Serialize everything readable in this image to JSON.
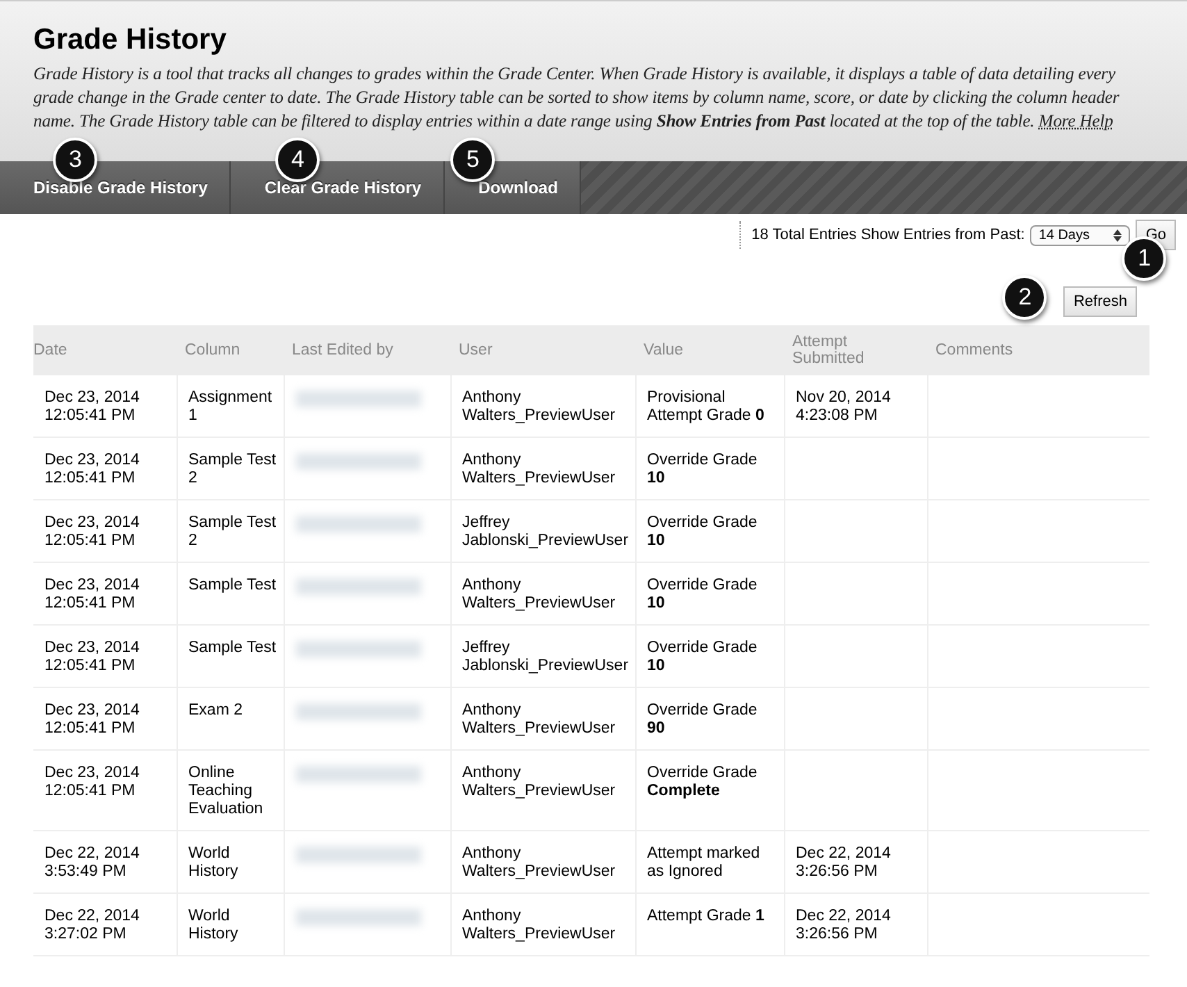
{
  "header": {
    "title": "Grade History",
    "description": "Grade History is a tool that tracks all changes to grades within the Grade Center. When Grade History is available, it displays a table of data detailing every grade change in the Grade center to date. The Grade History table can be sorted to show items by column name, score, or date by clicking the column header name. The Grade History table can be filtered to display entries within a date range using **Show Entries from Past** located at the top of the table.",
    "help_link": "More Help"
  },
  "toolbar": [
    {
      "label": "Disable Grade History",
      "callout": "3"
    },
    {
      "label": "Clear Grade History",
      "callout": "4"
    },
    {
      "label": "Download",
      "callout": "5"
    }
  ],
  "filter": {
    "total": "18 Total Entries",
    "label": "Show Entries from Past:",
    "select": "14 Days",
    "button": "Go",
    "callout": "1"
  },
  "refresh": {
    "label": "Refresh",
    "callout": "2"
  },
  "table": {
    "columns": [
      "Date",
      "Column",
      "Last Edited by",
      "User",
      "Value",
      "Attempt Submitted",
      "Comments"
    ],
    "rows": [
      {
        "date": "Dec 23, 2014 12:05:41 PM",
        "column": "Assignment 1",
        "user": "Anthony Walters_PreviewUser",
        "value": "Provisional Attempt Grade **0**",
        "attempt": "Nov 20, 2014 4:23:08 PM"
      },
      {
        "date": "Dec 23, 2014 12:05:41 PM",
        "column": "Sample Test 2",
        "user": "Anthony Walters_PreviewUser",
        "value": "Override Grade **10**",
        "attempt": ""
      },
      {
        "date": "Dec 23, 2014 12:05:41 PM",
        "column": "Sample Test 2",
        "user": "Jeffrey Jablonski_PreviewUser",
        "value": "Override Grade **10**",
        "attempt": ""
      },
      {
        "date": "Dec 23, 2014 12:05:41 PM",
        "column": "Sample Test",
        "user": "Anthony Walters_PreviewUser",
        "value": "Override Grade **10**",
        "attempt": ""
      },
      {
        "date": "Dec 23, 2014 12:05:41 PM",
        "column": "Sample Test",
        "user": "Jeffrey Jablonski_PreviewUser",
        "value": "Override Grade **10**",
        "attempt": ""
      },
      {
        "date": "Dec 23, 2014 12:05:41 PM",
        "column": "Exam 2",
        "user": "Anthony Walters_PreviewUser",
        "value": "Override Grade **90**",
        "attempt": ""
      },
      {
        "date": "Dec 23, 2014 12:05:41 PM",
        "column": "Online Teaching Evaluation",
        "user": "Anthony Walters_PreviewUser",
        "value": "Override Grade **Complete**",
        "attempt": ""
      },
      {
        "date": "Dec 22, 2014 3:53:49 PM",
        "column": "World History",
        "user": "Anthony Walters_PreviewUser",
        "value": "Attempt marked as Ignored",
        "attempt": "Dec 22, 2014 3:26:56 PM"
      },
      {
        "date": "Dec 22, 2014 3:27:02 PM",
        "column": "World History",
        "user": "Anthony Walters_PreviewUser",
        "value": "Attempt Grade **1**",
        "attempt": "Dec 22, 2014 3:26:56 PM"
      }
    ]
  }
}
